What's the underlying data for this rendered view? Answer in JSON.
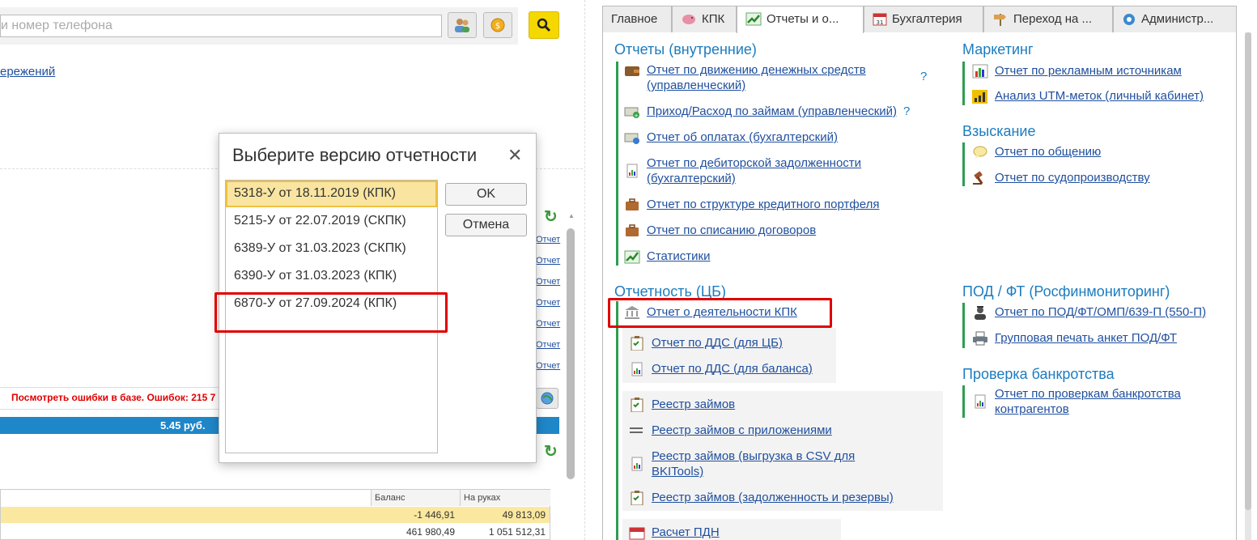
{
  "left": {
    "search_placeholder": "и номер телефона",
    "savings_link": "ережений",
    "small_links": [
      "Отчет",
      "Отчет",
      "Отчет",
      "Отчет",
      "Отчет",
      "Отчет",
      "Отчет"
    ],
    "error_text": "Посмотреть ошибки в базе. Ошибок: 215 7",
    "balance_bar": "5.45 руб.",
    "table": {
      "headers": [
        "Баланс",
        "На руках"
      ],
      "rows": [
        [
          "-1 446,91",
          "49 813,09"
        ],
        [
          "461 980,49",
          "1 051 512,31"
        ]
      ]
    }
  },
  "dialog": {
    "title": "Выберите версию отчетности",
    "items": [
      "5318-У от 18.11.2019 (КПК)",
      "5215-У от 22.07.2019 (СКПК)",
      "6389-У от 31.03.2023 (СКПК)",
      "6390-У от 31.03.2023 (КПК)",
      "6870-У от 27.09.2024 (КПК)"
    ],
    "selected": "5318-У от 18.11.2019 (КПК)",
    "ok": "OK",
    "cancel": "Отмена"
  },
  "tabs": [
    "Главное",
    "КПК",
    "Отчеты и о...",
    "Бухгалтерия",
    "Переход на ...",
    "Администр..."
  ],
  "active_tab": "Отчеты и о...",
  "sections": {
    "internal": {
      "title": "Отчеты (внутренние)",
      "items": [
        {
          "label": "Отчет по движению денежных средств (управленческий)",
          "icon": "wallet-icon",
          "help": "?"
        },
        {
          "label": "Приход/Расход по займам (управленческий)",
          "icon": "money-add-icon",
          "help": "?"
        },
        {
          "label": "Отчет об оплатах (бухгалтерский)",
          "icon": "money-icon"
        },
        {
          "label": "Отчет по дебиторской задолженности (бухгалтерский)",
          "icon": "report-doc-icon"
        },
        {
          "label": "Отчет по структуре кредитного портфеля",
          "icon": "briefcase-icon"
        },
        {
          "label": "Отчет по списанию договоров",
          "icon": "briefcase-icon"
        },
        {
          "label": "Статистики",
          "icon": "trend-icon"
        }
      ]
    },
    "cb": {
      "title": "Отчетность (ЦБ)",
      "items": [
        {
          "label": "Отчет о деятельности КПК",
          "icon": "bank-icon"
        },
        {
          "label": "Отчет по ДДС (для ЦБ)",
          "icon": "clipboard-icon"
        },
        {
          "label": "Отчет по ДДС (для баланса)",
          "icon": "report-doc-icon"
        },
        {
          "label": "Реестр займов",
          "icon": "clipboard-icon"
        },
        {
          "label": "Реестр займов с приложениями",
          "icon": "lines-icon"
        },
        {
          "label": "Реестр займов (выгрузка в CSV для BKITools)",
          "icon": "report-doc-icon"
        },
        {
          "label": "Реестр займов (задолженность и резервы)",
          "icon": "clipboard-icon"
        },
        {
          "label": "Расчет ПДН",
          "icon": "calendar-icon"
        }
      ]
    },
    "marketing": {
      "title": "Маркетинг",
      "items": [
        {
          "label": "Отчет по рекламным источникам",
          "icon": "bar-chart-icon"
        },
        {
          "label": "Анализ UTM-меток (личный кабинет)",
          "icon": "signal-icon"
        }
      ]
    },
    "collection": {
      "title": "Взыскание",
      "items": [
        {
          "label": "Отчет по общению",
          "icon": "speech-bubble-icon"
        },
        {
          "label": "Отчет по судопроизводству",
          "icon": "gavel-icon"
        }
      ]
    },
    "aml": {
      "title": "ПОД / ФТ (Росфинмониторинг)",
      "items": [
        {
          "label": "Отчет по ПОД/ФТ/ОМП/639-П (550-П)",
          "icon": "agent-icon"
        },
        {
          "label": "Групповая печать анкет ПОД/ФТ",
          "icon": "printer-icon"
        }
      ]
    },
    "bankruptcy": {
      "title": "Проверка банкротства",
      "items": [
        {
          "label": "Отчет по проверкам банкротства контрагентов",
          "icon": "report-doc-icon"
        }
      ]
    }
  }
}
